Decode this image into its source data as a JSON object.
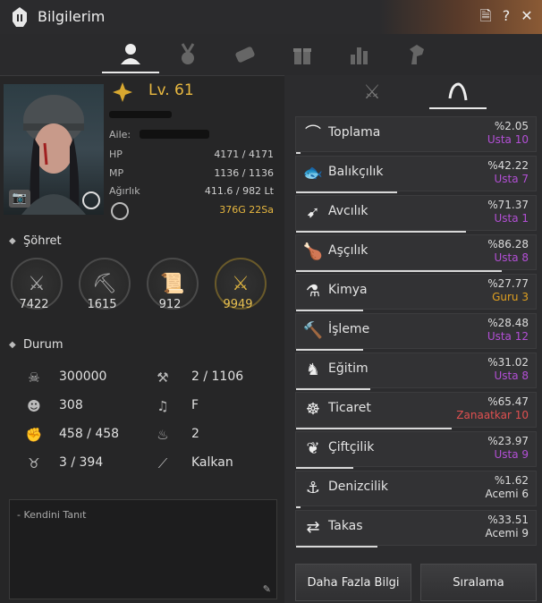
{
  "window": {
    "title": "Bilgilerim"
  },
  "top_tabs": [
    "profile-icon",
    "medal-icon",
    "scroll-icon",
    "gift-icon",
    "chart-icon",
    "horse-head-icon"
  ],
  "character": {
    "level": "Lv. 61",
    "family_label": "Aile:",
    "stats": [
      {
        "label": "HP",
        "value": "4171 / 4171"
      },
      {
        "label": "MP",
        "value": "1136 / 1136"
      },
      {
        "label": "Ağırlık",
        "value": "411.6 / 982 Lt"
      }
    ],
    "time_value": "376G 22Sa"
  },
  "fame": {
    "title": "Şöhret",
    "items": [
      {
        "icon": "crossed-swords-icon",
        "value": "7422"
      },
      {
        "icon": "axe-icon",
        "value": "1615"
      },
      {
        "icon": "scroll-icon",
        "value": "912"
      },
      {
        "icon": "gold-swords-icon",
        "value": "9949"
      }
    ]
  },
  "condition": {
    "title": "Durum",
    "items": [
      {
        "icon": "skull-icon",
        "value": "300000"
      },
      {
        "icon": "hammer-icon",
        "value": "2 / 1106"
      },
      {
        "icon": "soldier-icon",
        "value": "308"
      },
      {
        "icon": "music-icon",
        "value": "F"
      },
      {
        "icon": "arm-icon",
        "value": "458 / 458"
      },
      {
        "icon": "fire-icon",
        "value": "2"
      },
      {
        "icon": "taurus-icon",
        "value": "3 / 394"
      },
      {
        "icon": "wand-icon",
        "value": "Kalkan"
      }
    ]
  },
  "intro": {
    "placeholder": "- Kendini Tanıt"
  },
  "lifeskills": [
    {
      "name": "Toplama",
      "pct": "%2.05",
      "rank": "Usta 10",
      "rank_color": "#b34fd6",
      "progress": 0.02
    },
    {
      "name": "Balıkçılık",
      "pct": "%42.22",
      "rank": "Usta 7",
      "rank_color": "#b34fd6",
      "progress": 0.42
    },
    {
      "name": "Avcılık",
      "pct": "%71.37",
      "rank": "Usta 1",
      "rank_color": "#b34fd6",
      "progress": 0.71
    },
    {
      "name": "Aşçılık",
      "pct": "%86.28",
      "rank": "Usta 8",
      "rank_color": "#b34fd6",
      "progress": 0.86
    },
    {
      "name": "Kimya",
      "pct": "%27.77",
      "rank": "Guru 3",
      "rank_color": "#e0a020",
      "progress": 0.28
    },
    {
      "name": "İşleme",
      "pct": "%28.48",
      "rank": "Usta 12",
      "rank_color": "#b34fd6",
      "progress": 0.28
    },
    {
      "name": "Eğitim",
      "pct": "%31.02",
      "rank": "Usta 8",
      "rank_color": "#b34fd6",
      "progress": 0.31
    },
    {
      "name": "Ticaret",
      "pct": "%65.47",
      "rank": "Zanaatkar 10",
      "rank_color": "#e05050",
      "progress": 0.65
    },
    {
      "name": "Çiftçilik",
      "pct": "%23.97",
      "rank": "Usta 9",
      "rank_color": "#b34fd6",
      "progress": 0.24
    },
    {
      "name": "Denizcilik",
      "pct": "%1.62",
      "rank": "Acemi 6",
      "rank_color": "#e0e0e0",
      "progress": 0.02
    },
    {
      "name": "Takas",
      "pct": "%33.51",
      "rank": "Acemi 9",
      "rank_color": "#e0e0e0",
      "progress": 0.34
    }
  ],
  "buttons": {
    "more_info": "Daha Fazla Bilgi",
    "ranking": "Sıralama"
  }
}
